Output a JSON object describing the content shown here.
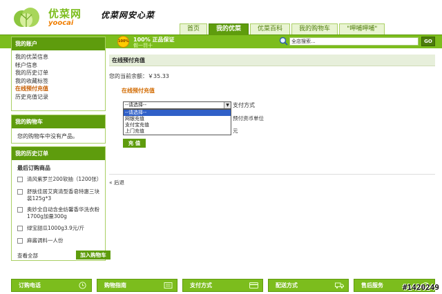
{
  "header": {
    "logo_cn": "优菜网",
    "logo_en": "yoocai",
    "slogan": "优菜网安心菜"
  },
  "nav": {
    "tabs": [
      {
        "label": "首页",
        "active": false
      },
      {
        "label": "我的优菜",
        "active": true
      },
      {
        "label": "优菜百科",
        "active": false
      },
      {
        "label": "我的购物车",
        "active": false
      },
      {
        "label": "\"呷哺呷哺\"",
        "active": false
      }
    ]
  },
  "promo": {
    "badge": "100%",
    "line1": "100% 正品保证",
    "line2": "假一罚十"
  },
  "search": {
    "value": "全店搜索...",
    "button": "GO"
  },
  "sidebar": {
    "account": {
      "title": "我的账户",
      "items": [
        {
          "label": "我的优菜信息"
        },
        {
          "label": "帐户信息"
        },
        {
          "label": "我的历史订单"
        },
        {
          "label": "我的收藏标签"
        },
        {
          "label": "在线预付充值"
        },
        {
          "label": "历史充值记录"
        }
      ]
    },
    "cart": {
      "title": "我的购物车",
      "empty_text": "您的购物车中没有产品。"
    },
    "history": {
      "title": "我的历史订单",
      "recent_title": "最后订购商品",
      "products": [
        {
          "name": "清风紫罗兰200软抽（1200张）"
        },
        {
          "name": "舒肤佳居艾爽清型香皂特惠三块装125g*3"
        },
        {
          "name": "奥妙全自动含金纺馨香华洗衣粉1700g加量300g"
        },
        {
          "name": "绿宝甜瓜1000g3.9元/斤"
        },
        {
          "name": "麻酱调料一人份"
        }
      ],
      "view_all": "查看全部",
      "add_to_cart": "加入购物车"
    }
  },
  "main": {
    "heading": "在线预付充值",
    "balance": "您的当前余额：￥35.33",
    "section_title": "在线预付充值",
    "select": {
      "value": "--请选择--",
      "options": [
        "--请选择--",
        "网银充值",
        "支付宝充值",
        "上门充值"
      ],
      "selected_index": 0
    },
    "pay_label": "支付方式",
    "unit_label": "预付资币单位",
    "yuan_label": "元",
    "submit": "充 值",
    "back": "« 后退"
  },
  "footer": {
    "items": [
      {
        "label": "订购电话",
        "icon": "clock-icon"
      },
      {
        "label": "购物指南",
        "icon": "guide-icon"
      },
      {
        "label": "支付方式",
        "icon": "card-icon"
      },
      {
        "label": "配送方式",
        "icon": "truck-icon"
      },
      {
        "label": "售后服务",
        "icon": "service-icon"
      }
    ]
  },
  "watermark": "#1420249",
  "colors": {
    "brand_green": "#7cbd1d",
    "dark_green": "#5e9c0d",
    "accent_orange": "#d26a00",
    "highlight_blue": "#3060c8"
  }
}
